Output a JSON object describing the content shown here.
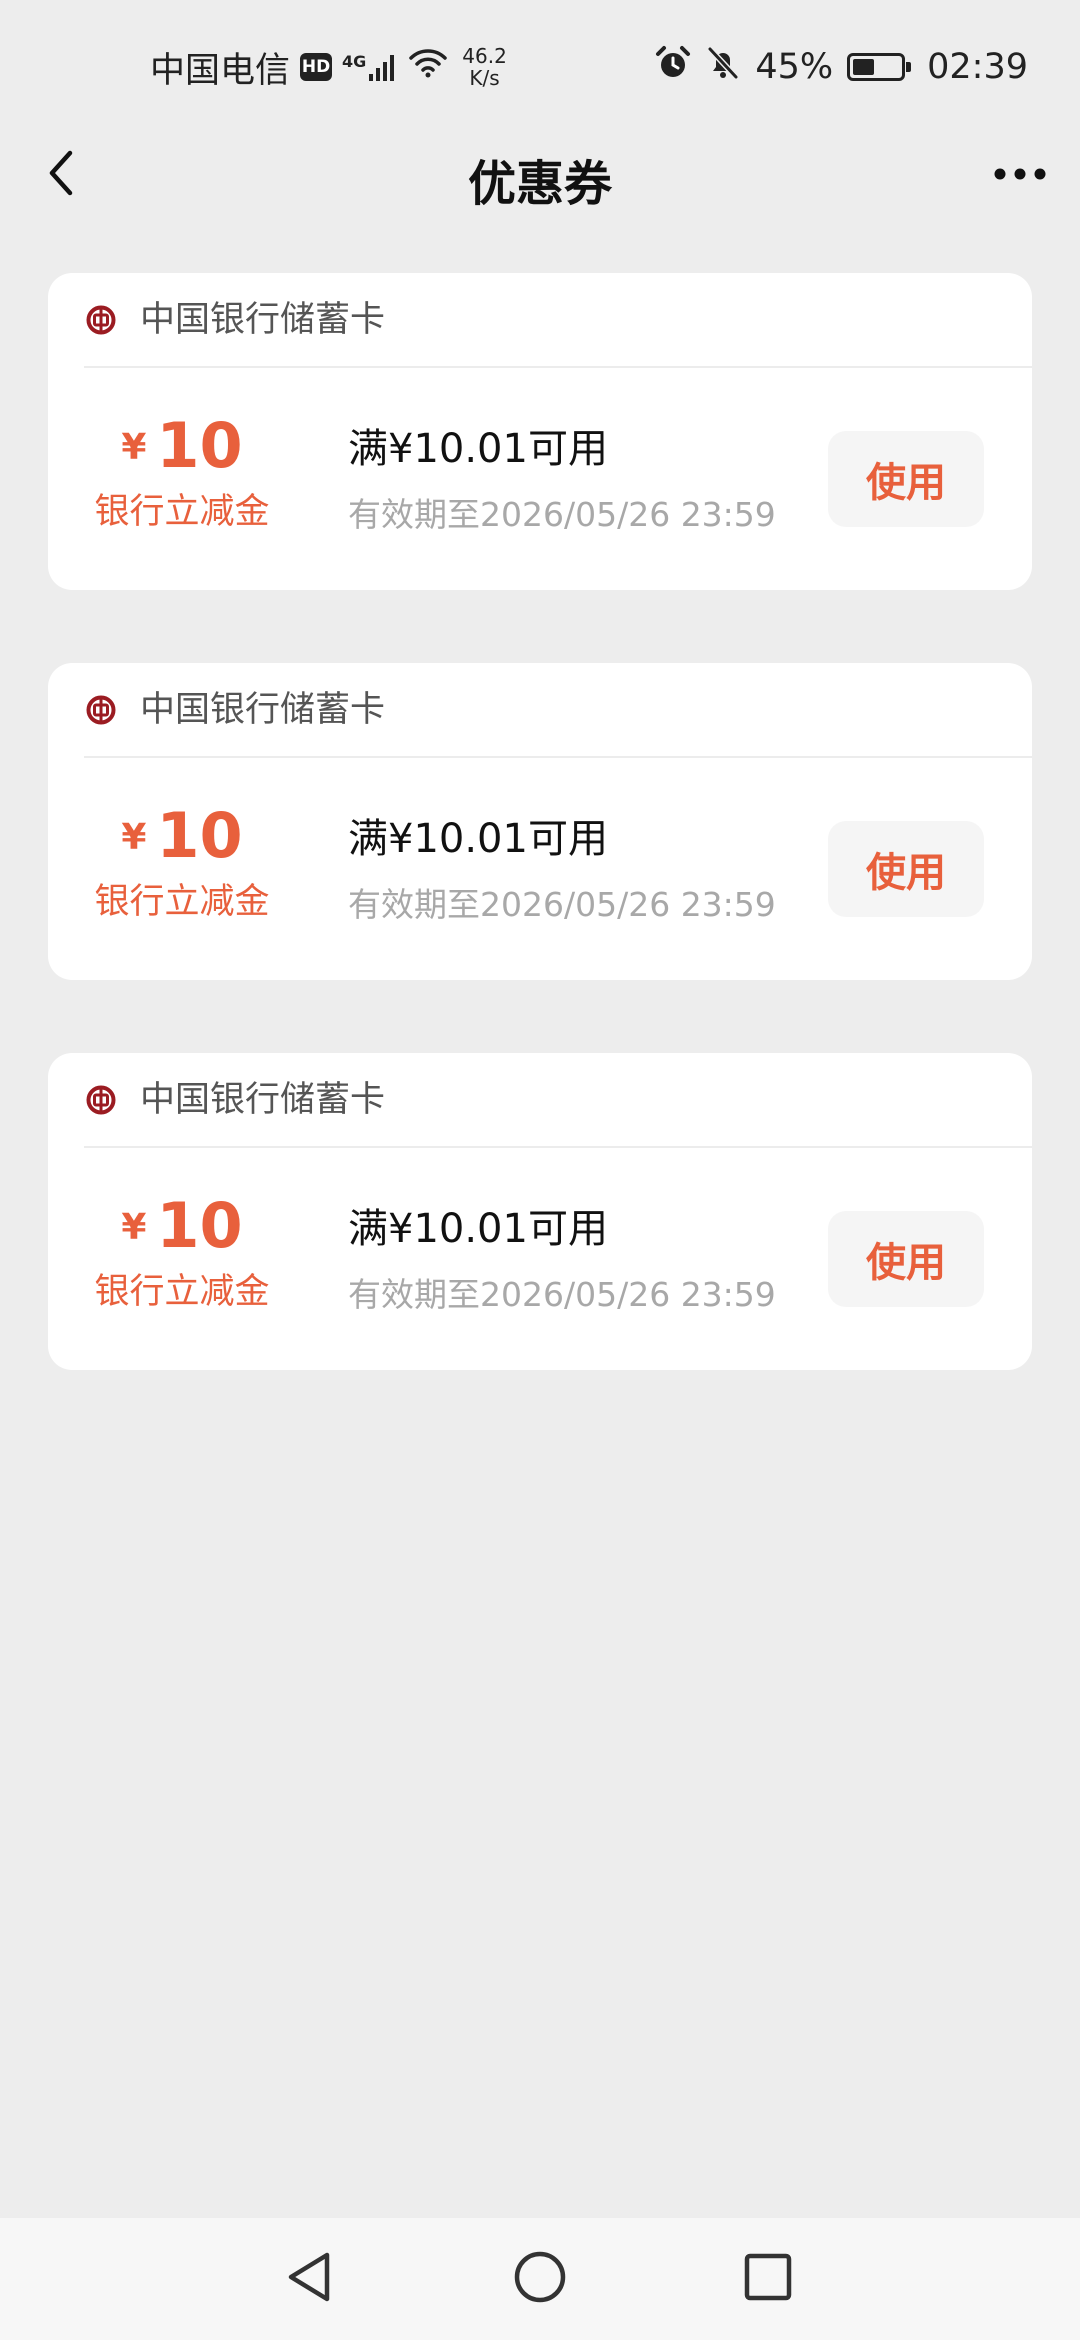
{
  "status_bar": {
    "carrier": "中国电信",
    "hd_badge": "HD",
    "network": "4G",
    "speed_value": "46.2",
    "speed_unit": "K/s",
    "battery_percent_text": "45%",
    "battery_level": 0.45,
    "time": "02:39"
  },
  "header": {
    "title": "优惠券",
    "back_icon": "chevron-left-icon",
    "more_icon": "more-horizontal-icon"
  },
  "colors": {
    "accent": "#e8603c",
    "background": "#ededed",
    "card": "#ffffff",
    "bank_logo": "#9b1c22",
    "button_bg": "#f5f5f5",
    "muted_text": "#a8a8a8"
  },
  "coupons": [
    {
      "bank": "中国银行储蓄卡",
      "currency_symbol": "¥",
      "amount": "10",
      "type_label": "银行立减金",
      "condition": "满¥10.01可用",
      "validity": "有效期至2026/05/26 23:59",
      "button_label": "使用"
    },
    {
      "bank": "中国银行储蓄卡",
      "currency_symbol": "¥",
      "amount": "10",
      "type_label": "银行立减金",
      "condition": "满¥10.01可用",
      "validity": "有效期至2026/05/26 23:59",
      "button_label": "使用"
    },
    {
      "bank": "中国银行储蓄卡",
      "currency_symbol": "¥",
      "amount": "10",
      "type_label": "银行立减金",
      "condition": "满¥10.01可用",
      "validity": "有效期至2026/05/26 23:59",
      "button_label": "使用"
    }
  ],
  "nav_bar": {
    "back_icon": "triangle-back-icon",
    "home_icon": "circle-home-icon",
    "recent_icon": "square-recent-icon"
  }
}
